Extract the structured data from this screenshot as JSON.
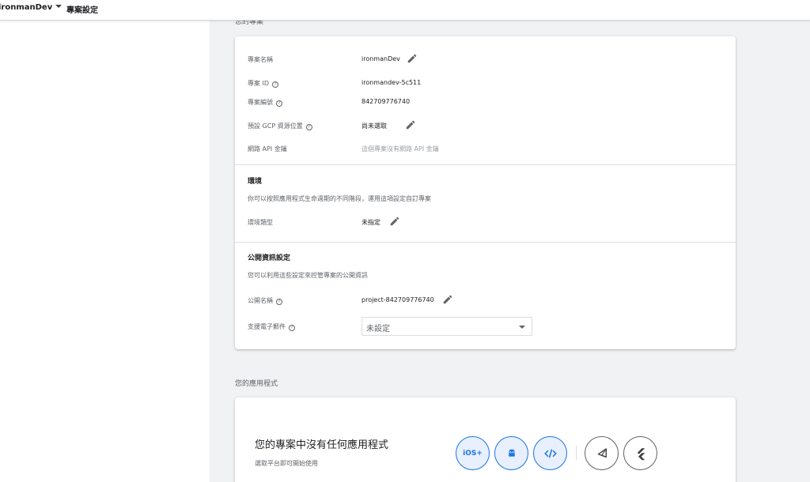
{
  "topbar": {
    "project_name": "ironmanDev",
    "breadcrumb": "專案設定"
  },
  "sections": {
    "your_project": "您的專案",
    "your_apps": "您的應用程式"
  },
  "project_info": {
    "name_label": "專案名稱",
    "name_value": "ironmanDev",
    "id_label": "專案 ID",
    "id_value": "ironmandev-5c511",
    "number_label": "專案編號",
    "number_value": "842709776740",
    "gcp_label": "預設 GCP 資源位置",
    "gcp_value": "尚未選取",
    "apikey_label": "網路 API 金鑰",
    "apikey_value": "這個專案沒有網路 API 金鑰"
  },
  "environment": {
    "title": "環境",
    "description": "你可以按照應用程式生命週期的不同階段，運用這項設定自訂專案",
    "type_label": "環境類型",
    "type_value": "未指定"
  },
  "public_settings": {
    "title": "公開資訊設定",
    "description": "您可以利用這些設定來控管專案的公開資訊",
    "public_name_label": "公開名稱",
    "public_name_value": "project-842709776740",
    "support_email_label": "支援電子郵件",
    "support_email_value": "未設定"
  },
  "apps": {
    "heading": "您的專案中沒有任何應用程式",
    "subtext": "選取平台即可開始使用",
    "platforms": [
      "iOS+",
      "Android",
      "Web",
      "Unity",
      "Flutter"
    ]
  },
  "colors": {
    "accent": "#1a73e8",
    "accent_bg": "#e8f0fe",
    "text": "#202124",
    "secondary_text": "#5f6368",
    "background": "#f1f2f4"
  }
}
